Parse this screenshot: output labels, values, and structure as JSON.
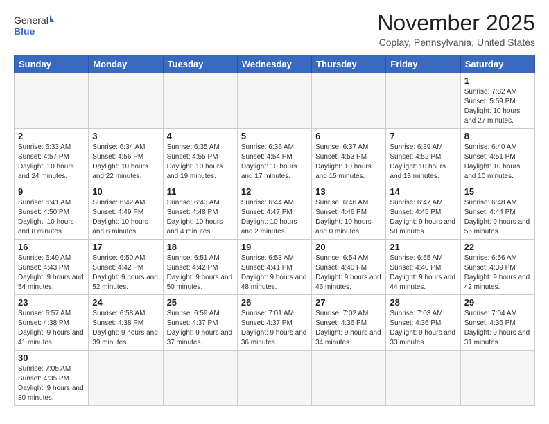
{
  "header": {
    "logo_general": "General",
    "logo_blue": "Blue",
    "month_title": "November 2025",
    "location": "Coplay, Pennsylvania, United States"
  },
  "weekdays": [
    "Sunday",
    "Monday",
    "Tuesday",
    "Wednesday",
    "Thursday",
    "Friday",
    "Saturday"
  ],
  "weeks": [
    [
      {
        "num": "",
        "info": ""
      },
      {
        "num": "",
        "info": ""
      },
      {
        "num": "",
        "info": ""
      },
      {
        "num": "",
        "info": ""
      },
      {
        "num": "",
        "info": ""
      },
      {
        "num": "",
        "info": ""
      },
      {
        "num": "1",
        "info": "Sunrise: 7:32 AM\nSunset: 5:59 PM\nDaylight: 10 hours and 27 minutes."
      }
    ],
    [
      {
        "num": "2",
        "info": "Sunrise: 6:33 AM\nSunset: 4:57 PM\nDaylight: 10 hours and 24 minutes."
      },
      {
        "num": "3",
        "info": "Sunrise: 6:34 AM\nSunset: 4:56 PM\nDaylight: 10 hours and 22 minutes."
      },
      {
        "num": "4",
        "info": "Sunrise: 6:35 AM\nSunset: 4:55 PM\nDaylight: 10 hours and 19 minutes."
      },
      {
        "num": "5",
        "info": "Sunrise: 6:36 AM\nSunset: 4:54 PM\nDaylight: 10 hours and 17 minutes."
      },
      {
        "num": "6",
        "info": "Sunrise: 6:37 AM\nSunset: 4:53 PM\nDaylight: 10 hours and 15 minutes."
      },
      {
        "num": "7",
        "info": "Sunrise: 6:39 AM\nSunset: 4:52 PM\nDaylight: 10 hours and 13 minutes."
      },
      {
        "num": "8",
        "info": "Sunrise: 6:40 AM\nSunset: 4:51 PM\nDaylight: 10 hours and 10 minutes."
      }
    ],
    [
      {
        "num": "9",
        "info": "Sunrise: 6:41 AM\nSunset: 4:50 PM\nDaylight: 10 hours and 8 minutes."
      },
      {
        "num": "10",
        "info": "Sunrise: 6:42 AM\nSunset: 4:49 PM\nDaylight: 10 hours and 6 minutes."
      },
      {
        "num": "11",
        "info": "Sunrise: 6:43 AM\nSunset: 4:48 PM\nDaylight: 10 hours and 4 minutes."
      },
      {
        "num": "12",
        "info": "Sunrise: 6:44 AM\nSunset: 4:47 PM\nDaylight: 10 hours and 2 minutes."
      },
      {
        "num": "13",
        "info": "Sunrise: 6:46 AM\nSunset: 4:46 PM\nDaylight: 10 hours and 0 minutes."
      },
      {
        "num": "14",
        "info": "Sunrise: 6:47 AM\nSunset: 4:45 PM\nDaylight: 9 hours and 58 minutes."
      },
      {
        "num": "15",
        "info": "Sunrise: 6:48 AM\nSunset: 4:44 PM\nDaylight: 9 hours and 56 minutes."
      }
    ],
    [
      {
        "num": "16",
        "info": "Sunrise: 6:49 AM\nSunset: 4:43 PM\nDaylight: 9 hours and 54 minutes."
      },
      {
        "num": "17",
        "info": "Sunrise: 6:50 AM\nSunset: 4:42 PM\nDaylight: 9 hours and 52 minutes."
      },
      {
        "num": "18",
        "info": "Sunrise: 6:51 AM\nSunset: 4:42 PM\nDaylight: 9 hours and 50 minutes."
      },
      {
        "num": "19",
        "info": "Sunrise: 6:53 AM\nSunset: 4:41 PM\nDaylight: 9 hours and 48 minutes."
      },
      {
        "num": "20",
        "info": "Sunrise: 6:54 AM\nSunset: 4:40 PM\nDaylight: 9 hours and 46 minutes."
      },
      {
        "num": "21",
        "info": "Sunrise: 6:55 AM\nSunset: 4:40 PM\nDaylight: 9 hours and 44 minutes."
      },
      {
        "num": "22",
        "info": "Sunrise: 6:56 AM\nSunset: 4:39 PM\nDaylight: 9 hours and 42 minutes."
      }
    ],
    [
      {
        "num": "23",
        "info": "Sunrise: 6:57 AM\nSunset: 4:38 PM\nDaylight: 9 hours and 41 minutes."
      },
      {
        "num": "24",
        "info": "Sunrise: 6:58 AM\nSunset: 4:38 PM\nDaylight: 9 hours and 39 minutes."
      },
      {
        "num": "25",
        "info": "Sunrise: 6:59 AM\nSunset: 4:37 PM\nDaylight: 9 hours and 37 minutes."
      },
      {
        "num": "26",
        "info": "Sunrise: 7:01 AM\nSunset: 4:37 PM\nDaylight: 9 hours and 36 minutes."
      },
      {
        "num": "27",
        "info": "Sunrise: 7:02 AM\nSunset: 4:36 PM\nDaylight: 9 hours and 34 minutes."
      },
      {
        "num": "28",
        "info": "Sunrise: 7:03 AM\nSunset: 4:36 PM\nDaylight: 9 hours and 33 minutes."
      },
      {
        "num": "29",
        "info": "Sunrise: 7:04 AM\nSunset: 4:36 PM\nDaylight: 9 hours and 31 minutes."
      }
    ],
    [
      {
        "num": "30",
        "info": "Sunrise: 7:05 AM\nSunset: 4:35 PM\nDaylight: 9 hours and 30 minutes."
      },
      {
        "num": "",
        "info": ""
      },
      {
        "num": "",
        "info": ""
      },
      {
        "num": "",
        "info": ""
      },
      {
        "num": "",
        "info": ""
      },
      {
        "num": "",
        "info": ""
      },
      {
        "num": "",
        "info": ""
      }
    ]
  ]
}
